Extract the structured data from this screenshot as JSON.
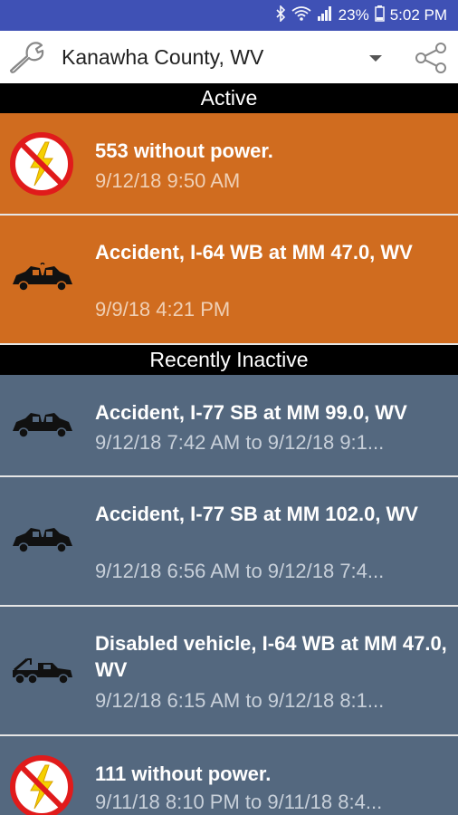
{
  "status_bar": {
    "battery": "23%",
    "time": "5:02 PM",
    "icons": [
      "bluetooth-icon",
      "wifi-icon",
      "signal-icon",
      "battery-icon"
    ]
  },
  "app_bar": {
    "location": "Kanawha County, WV",
    "icons": [
      "wrench-icon",
      "dropdown-icon",
      "share-icon"
    ]
  },
  "sections": {
    "active": "Active",
    "inactive": "Recently Inactive"
  },
  "active_items": [
    {
      "icon": "no-power-icon",
      "title": "553 without power.",
      "time": "9/12/18 9:50 AM"
    },
    {
      "icon": "car-crash-icon",
      "title": "Accident, I-64 WB at MM 47.0, WV",
      "time": "9/9/18 4:21 PM"
    }
  ],
  "inactive_items": [
    {
      "icon": "car-crash-icon",
      "title": "Accident, I-77 SB at MM 99.0, WV",
      "time": "9/12/18 7:42 AM to 9/12/18 9:1..."
    },
    {
      "icon": "car-crash-icon",
      "title": "Accident, I-77 SB at MM 102.0, WV",
      "time": "9/12/18 6:56 AM to 9/12/18 7:4..."
    },
    {
      "icon": "tow-truck-icon",
      "title": "Disabled vehicle, I-64 WB at MM 47.0, WV",
      "time": "9/12/18 6:15 AM to 9/12/18 8:1..."
    },
    {
      "icon": "no-power-icon",
      "title": "111 without power.",
      "time": "9/11/18 8:10 PM to 9/11/18 8:4..."
    }
  ],
  "colors": {
    "active_bg": "#d06c1f",
    "inactive_bg": "#54687f",
    "status_bar": "#3f51b5"
  }
}
